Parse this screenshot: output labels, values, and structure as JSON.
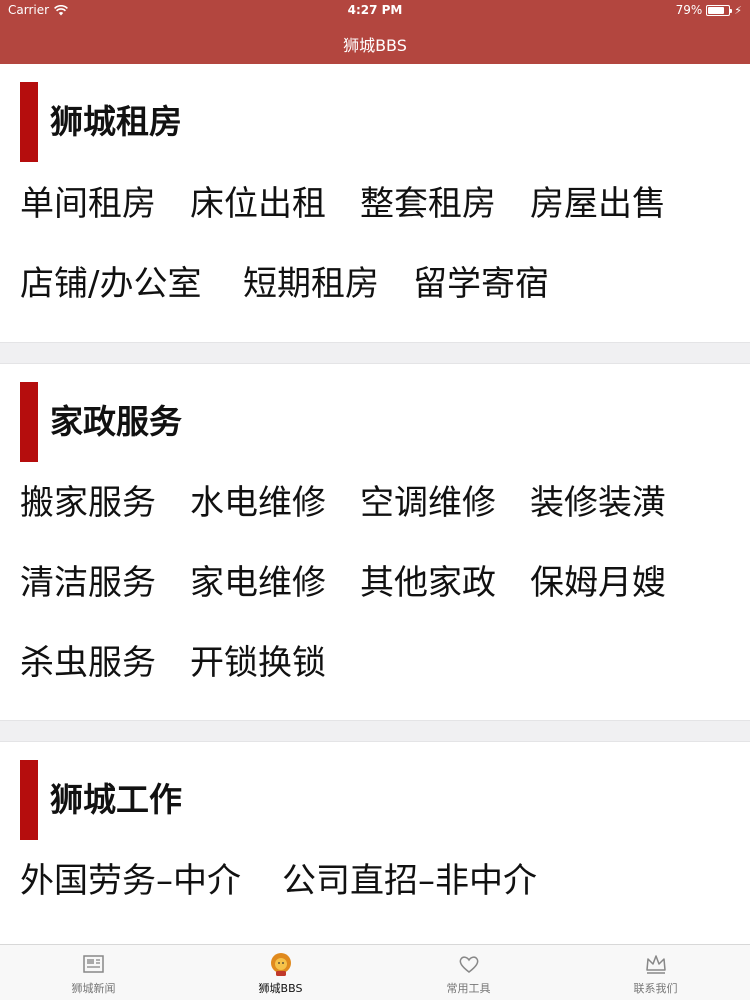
{
  "status_bar": {
    "carrier": "Carrier",
    "time": "4:27 PM",
    "battery_percent": "79%",
    "battery_level": 0.79
  },
  "nav": {
    "title": "狮城BBS"
  },
  "sections": [
    {
      "title": "狮城租房",
      "items": [
        "单间租房",
        "床位出租",
        "整套租房",
        "房屋出售",
        "店铺/办公室",
        "短期租房",
        "留学寄宿"
      ]
    },
    {
      "title": "家政服务",
      "items": [
        "搬家服务",
        "水电维修",
        "空调维修",
        "装修装潢",
        "清洁服务",
        "家电维修",
        "其他家政",
        "保姆月嫂",
        "杀虫服务",
        "开锁换锁"
      ]
    },
    {
      "title": "狮城工作",
      "items": [
        "外国劳务–中介",
        "公司直招–非中介"
      ]
    }
  ],
  "tabbar": {
    "tabs": [
      {
        "label": "狮城新闻",
        "icon": "newspaper-icon"
      },
      {
        "label": "狮城BBS",
        "icon": "lion-icon",
        "active": true
      },
      {
        "label": "常用工具",
        "icon": "heart-icon"
      },
      {
        "label": "联系我们",
        "icon": "crown-icon"
      }
    ]
  },
  "colors": {
    "nav_background": "#b3463f",
    "section_accent": "#b50d0d",
    "separator": "#f0f0f2"
  }
}
